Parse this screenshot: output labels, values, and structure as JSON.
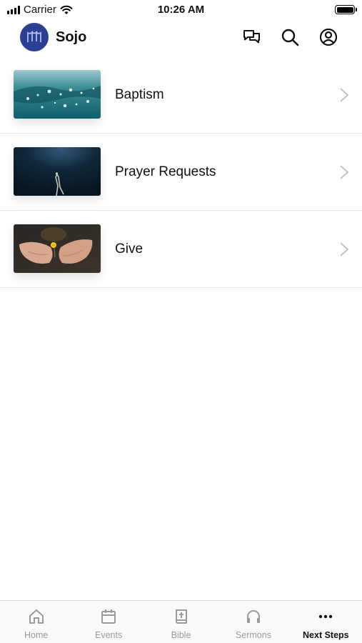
{
  "status_bar": {
    "carrier": "Carrier",
    "time": "10:26 AM"
  },
  "header": {
    "app_name": "Sojo",
    "icons": [
      "chat-icon",
      "search-icon",
      "profile-icon"
    ],
    "logo_color": "#2b3f93"
  },
  "list": {
    "items": [
      {
        "label": "Baptism",
        "image": "water-droplets-image"
      },
      {
        "label": "Prayer Requests",
        "image": "dark-figure-image"
      },
      {
        "label": "Give",
        "image": "hands-flower-image"
      }
    ]
  },
  "tab_bar": {
    "tabs": [
      {
        "label": "Home",
        "icon": "home-icon",
        "active": false
      },
      {
        "label": "Events",
        "icon": "calendar-icon",
        "active": false
      },
      {
        "label": "Bible",
        "icon": "bible-icon",
        "active": false
      },
      {
        "label": "Sermons",
        "icon": "headphones-icon",
        "active": false
      },
      {
        "label": "Next Steps",
        "icon": "more-icon",
        "active": true
      }
    ]
  }
}
